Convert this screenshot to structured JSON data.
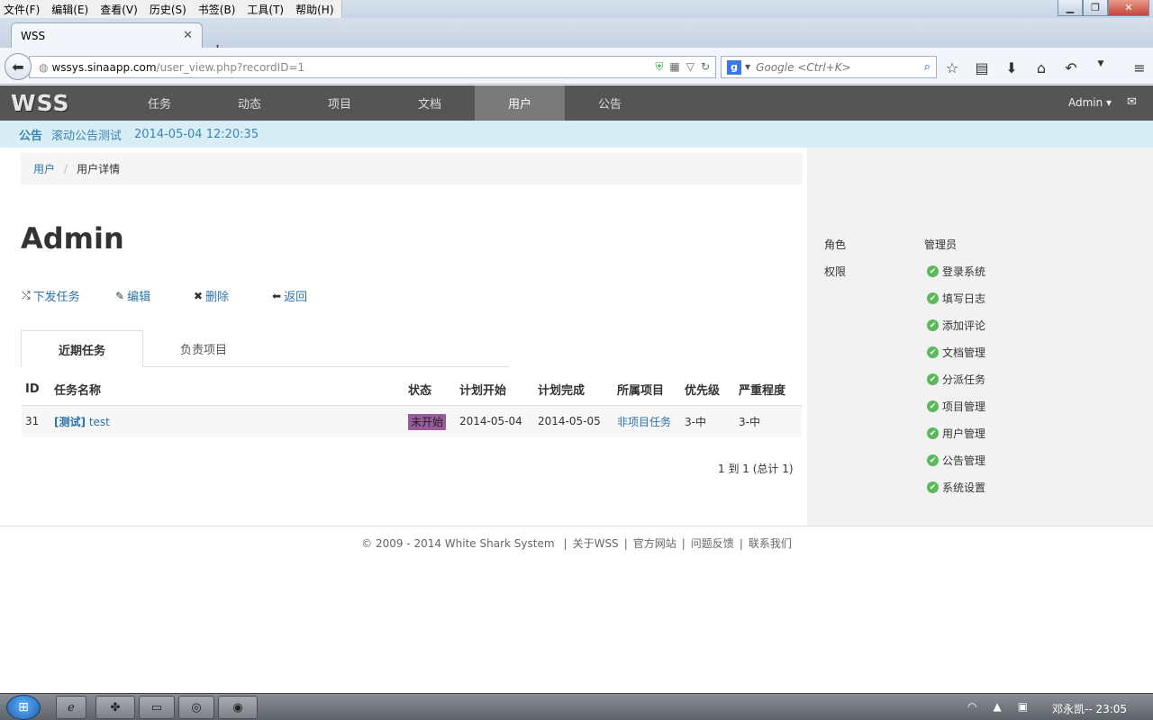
{
  "browser": {
    "menu": [
      "文件(F)",
      "编辑(E)",
      "查看(V)",
      "历史(S)",
      "书签(B)",
      "工具(T)",
      "帮助(H)"
    ],
    "tab_title": "WSS",
    "url_host": "wssys.sinaapp.com",
    "url_path": "/user_view.php?recordID=1",
    "search_placeholder": "Google <Ctrl+K>"
  },
  "app": {
    "logo": "WSS",
    "nav": [
      "任务",
      "动态",
      "项目",
      "文档",
      "用户",
      "公告"
    ],
    "active_nav": "用户",
    "user_menu": "Admin ▾"
  },
  "notice": {
    "label": "公告",
    "text": "滚动公告测试",
    "time": "2014-05-04 12:20:35"
  },
  "breadcrumb": {
    "parent": "用户",
    "separator": "/",
    "current": "用户详情"
  },
  "page_title": "Admin",
  "actions": {
    "assign": "下发任务",
    "edit": "编辑",
    "delete": "删除",
    "back": "返回"
  },
  "tabs": {
    "recent": "近期任务",
    "projects": "负责项目"
  },
  "table": {
    "headers": [
      "ID",
      "任务名称",
      "状态",
      "计划开始",
      "计划完成",
      "所属项目",
      "优先级",
      "严重程度"
    ],
    "rows": [
      {
        "id": "31",
        "tag": "[测试]",
        "name": "test",
        "status": "未开始",
        "start": "2014-05-04",
        "end": "2014-05-05",
        "project": "非项目任务",
        "priority": "3-中",
        "severity": "3-中"
      }
    ]
  },
  "pager": "1 到 1 (总计 1)",
  "sidebar": {
    "role_label": "角色",
    "role_value": "管理员",
    "perm_label": "权限",
    "permissions": [
      "登录系统",
      "填写日志",
      "添加评论",
      "文档管理",
      "分派任务",
      "项目管理",
      "用户管理",
      "公告管理",
      "系统设置"
    ]
  },
  "footer": {
    "copyright": "© 2009 - 2014 White Shark System",
    "links": [
      "关于WSS",
      "官方网站",
      "问题反馈",
      "联系我们"
    ]
  },
  "taskbar": {
    "clock": "邓永凯-- 23:05"
  },
  "colors": {
    "accent": "#2a73a8",
    "nav_bg": "#555555",
    "notice_bg": "#d9edf7",
    "status_badge": "#9b5a9b",
    "check": "#5cb85c"
  }
}
